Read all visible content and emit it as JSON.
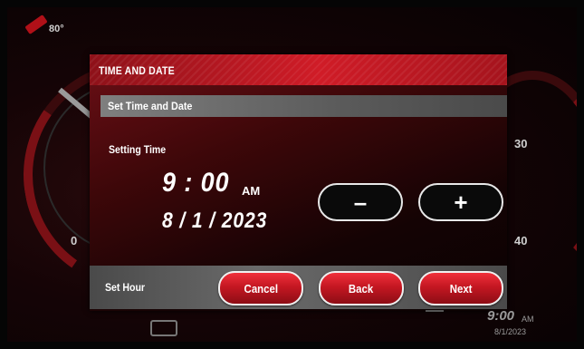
{
  "background": {
    "temperature": "80°",
    "gauge_left_tick": "0",
    "gauge_right_ticks": [
      "30",
      "40"
    ],
    "clock": {
      "time": "9:00",
      "ampm": "AM",
      "date": "8/1/2023"
    }
  },
  "dialog": {
    "title": "TIME AND DATE",
    "subheader": "Set Time and Date",
    "setting_label": "Setting Time",
    "time": "9 : 00",
    "ampm": "AM",
    "date": "8 / 1 / 2023",
    "stepper": {
      "minus": "–",
      "plus": "+"
    },
    "footer": {
      "label": "Set Hour",
      "cancel": "Cancel",
      "back": "Back",
      "next": "Next"
    }
  },
  "colors": {
    "accent": "#d01c27",
    "button": "#c41722"
  }
}
